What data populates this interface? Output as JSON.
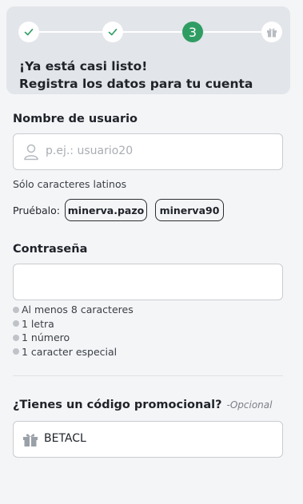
{
  "progress": {
    "steps": [
      {
        "state": "done",
        "icon": "check-icon"
      },
      {
        "state": "done",
        "icon": "check-icon"
      },
      {
        "state": "current",
        "number": "3"
      },
      {
        "state": "future",
        "icon": "gift-icon"
      }
    ],
    "title_line1": "¡Ya está casi listo!",
    "title_line2": "Registra los datos para tu cuenta"
  },
  "username": {
    "label": "Nombre de usuario",
    "placeholder": "p.ej.: usuario20",
    "helper": "Sólo caracteres latinos",
    "suggest_label": "Pruébalo:",
    "suggestions": [
      "minerva.pazo",
      "minerva90"
    ]
  },
  "password": {
    "label": "Contraseña",
    "value": "",
    "rules": [
      "Al menos 8 caracteres",
      "1 letra",
      "1 número",
      "1 caracter especial"
    ]
  },
  "promo": {
    "label": "¿Tienes un código promocional?",
    "optional": "-Opcional",
    "value": "BETACL"
  },
  "colors": {
    "accent": "#2f9d63",
    "card": "#e2e5e9",
    "check": "#2f9d63"
  }
}
